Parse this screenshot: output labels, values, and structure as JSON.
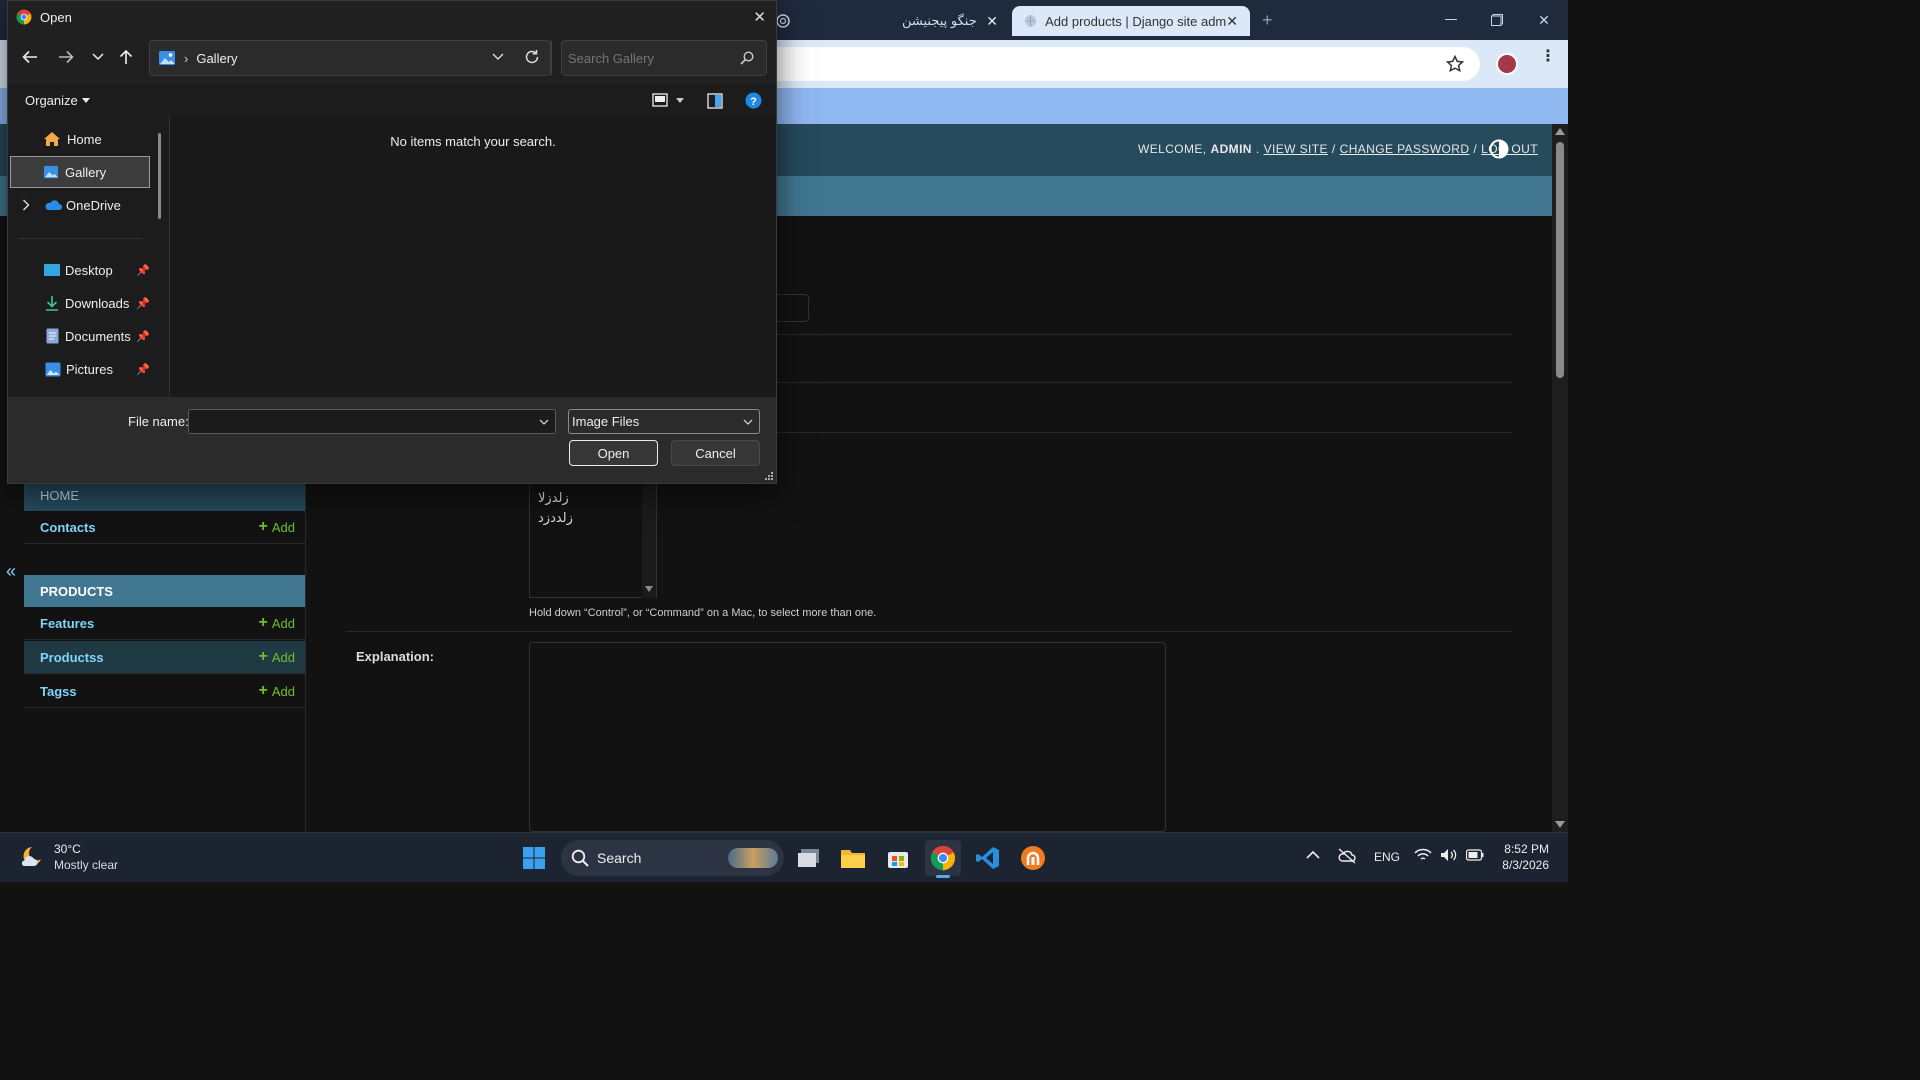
{
  "chrome": {
    "tabs": [
      {
        "label": "جنگو پیجنیشن",
        "active": false
      },
      {
        "label": "Add products | Django site adm",
        "active": true
      }
    ],
    "new_tab": "+"
  },
  "django": {
    "user_tools": {
      "welcome": "WELCOME,",
      "user": "ADMIN",
      "sep1": ".",
      "view_site": "VIEW SITE",
      "sep2": "/",
      "change_password": "CHANGE PASSWORD",
      "sep3": "/",
      "log_out": "LOG OUT"
    },
    "sidebar": {
      "home_caption": "HOME",
      "contacts": {
        "label": "Contacts",
        "add": "Add"
      },
      "products_caption": "PRODUCTS",
      "features": {
        "label": "Features",
        "add": "Add"
      },
      "products": {
        "label": "Productss",
        "add": "Add"
      },
      "tags": {
        "label": "Tagss",
        "add": "Add"
      },
      "collapse": "«"
    },
    "form": {
      "select_options": [
        "زلدزلا",
        "زلددزد"
      ],
      "help_text": "Hold down “Control”, or “Command” on a Mac, to select more than one.",
      "explanation_label": "Explanation:"
    }
  },
  "dialog": {
    "title": "Open",
    "path": {
      "sep": "›",
      "location": "Gallery"
    },
    "search_placeholder": "Search Gallery",
    "organize": "Organize",
    "nav": {
      "quick": [
        "Home",
        "Gallery",
        "OneDrive"
      ],
      "pinned": [
        "Desktop",
        "Downloads",
        "Documents",
        "Pictures"
      ]
    },
    "empty_message": "No items match your search.",
    "file_name_label": "File name:",
    "file_name_value": "",
    "file_type": "Image Files",
    "open_button": "Open",
    "cancel_button": "Cancel"
  },
  "taskbar": {
    "weather": {
      "temp": "30°C",
      "condition": "Mostly clear"
    },
    "search": "Search",
    "lang": "ENG",
    "time": "8:52 PM",
    "date": "8/3/2026"
  },
  "colors": {
    "django_header": "#264b5d",
    "django_nav": "#417690",
    "link": "#81d4fa",
    "add": "#70bf2b",
    "dialog_bg": "#202020"
  }
}
